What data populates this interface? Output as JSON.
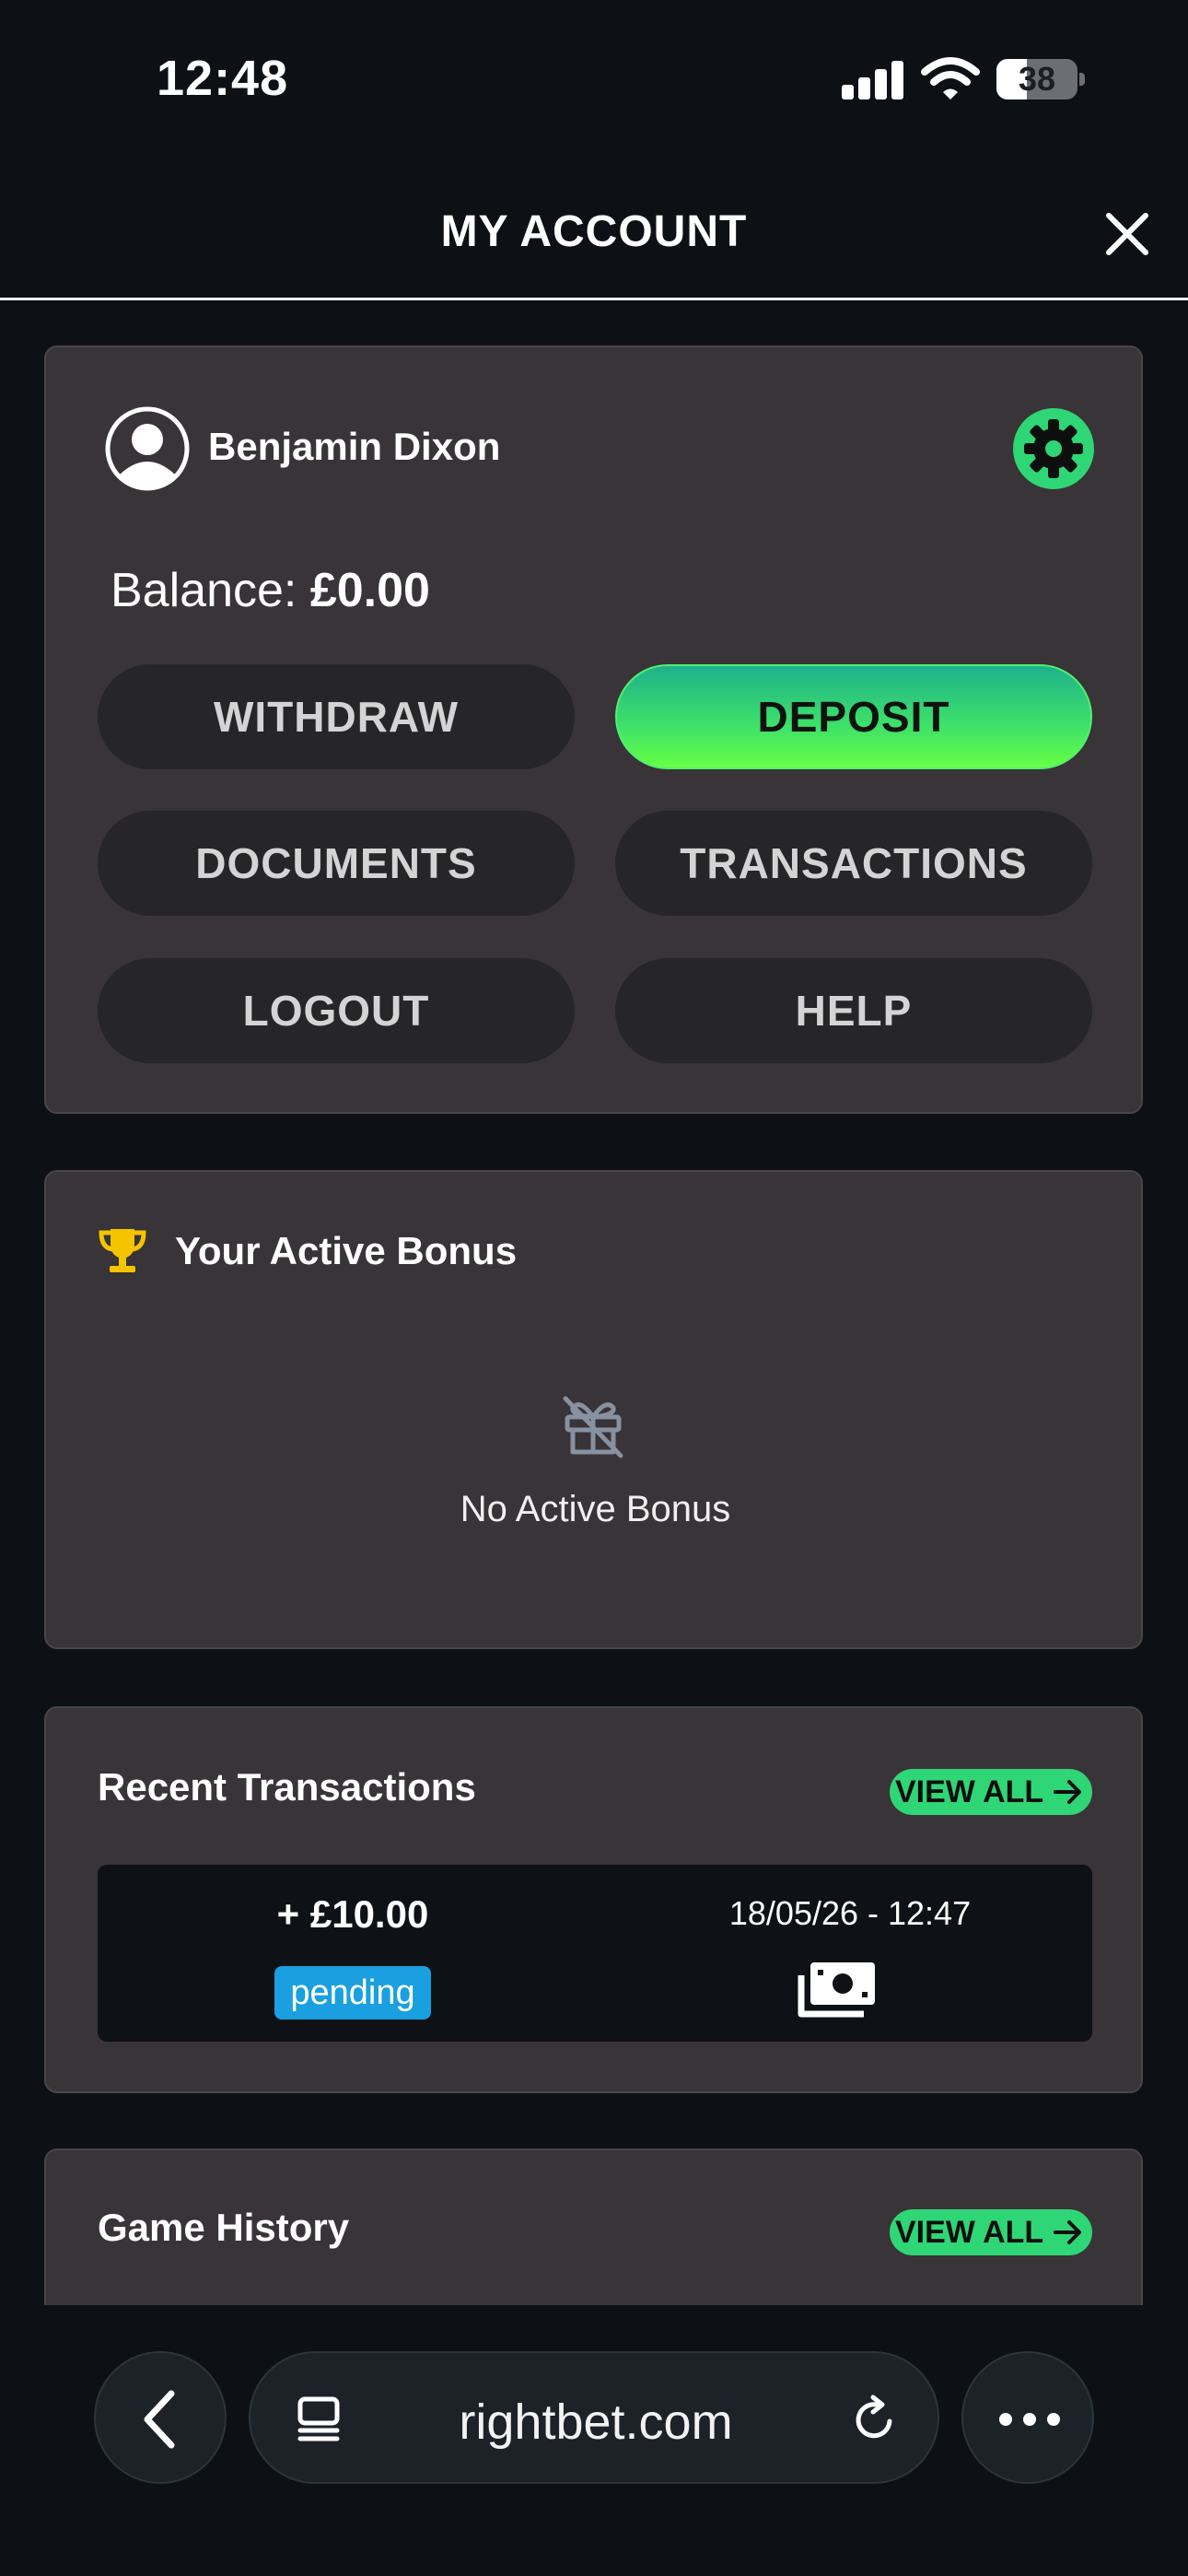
{
  "status": {
    "time": "12:48",
    "battery": "38",
    "battery_level": 0.38
  },
  "header": {
    "title": "MY ACCOUNT"
  },
  "account": {
    "user_name": "Benjamin Dixon",
    "balance_label": "Balance:",
    "balance_value": "£0.00",
    "buttons": {
      "withdraw": "WITHDRAW",
      "deposit": "DEPOSIT",
      "documents": "DOCUMENTS",
      "transactions": "TRANSACTIONS",
      "logout": "LOGOUT",
      "help": "HELP"
    }
  },
  "bonus": {
    "title": "Your Active Bonus",
    "empty_text": "No Active Bonus"
  },
  "transactions": {
    "title": "Recent Transactions",
    "view_all": "VIEW ALL",
    "items": [
      {
        "amount": "+ £10.00",
        "date": "18/05/26 - 12:47",
        "status": "pending"
      }
    ]
  },
  "game_history": {
    "title": "Game History",
    "view_all": "VIEW ALL"
  },
  "browser": {
    "url": "rightbet.com"
  },
  "colors": {
    "accent_green": "#2fd676",
    "card_bg": "#383437",
    "page_bg": "#0d1116",
    "pending_blue": "#1aa0e0",
    "trophy_gold": "#f5c400"
  },
  "icons": [
    "signal-icon",
    "wifi-icon",
    "battery-icon",
    "close-icon",
    "avatar-icon",
    "gear-icon",
    "trophy-icon",
    "gift-off-icon",
    "arrow-right-icon",
    "cash-icon",
    "chevron-left-icon",
    "tabs-icon",
    "reload-icon",
    "more-icon"
  ]
}
